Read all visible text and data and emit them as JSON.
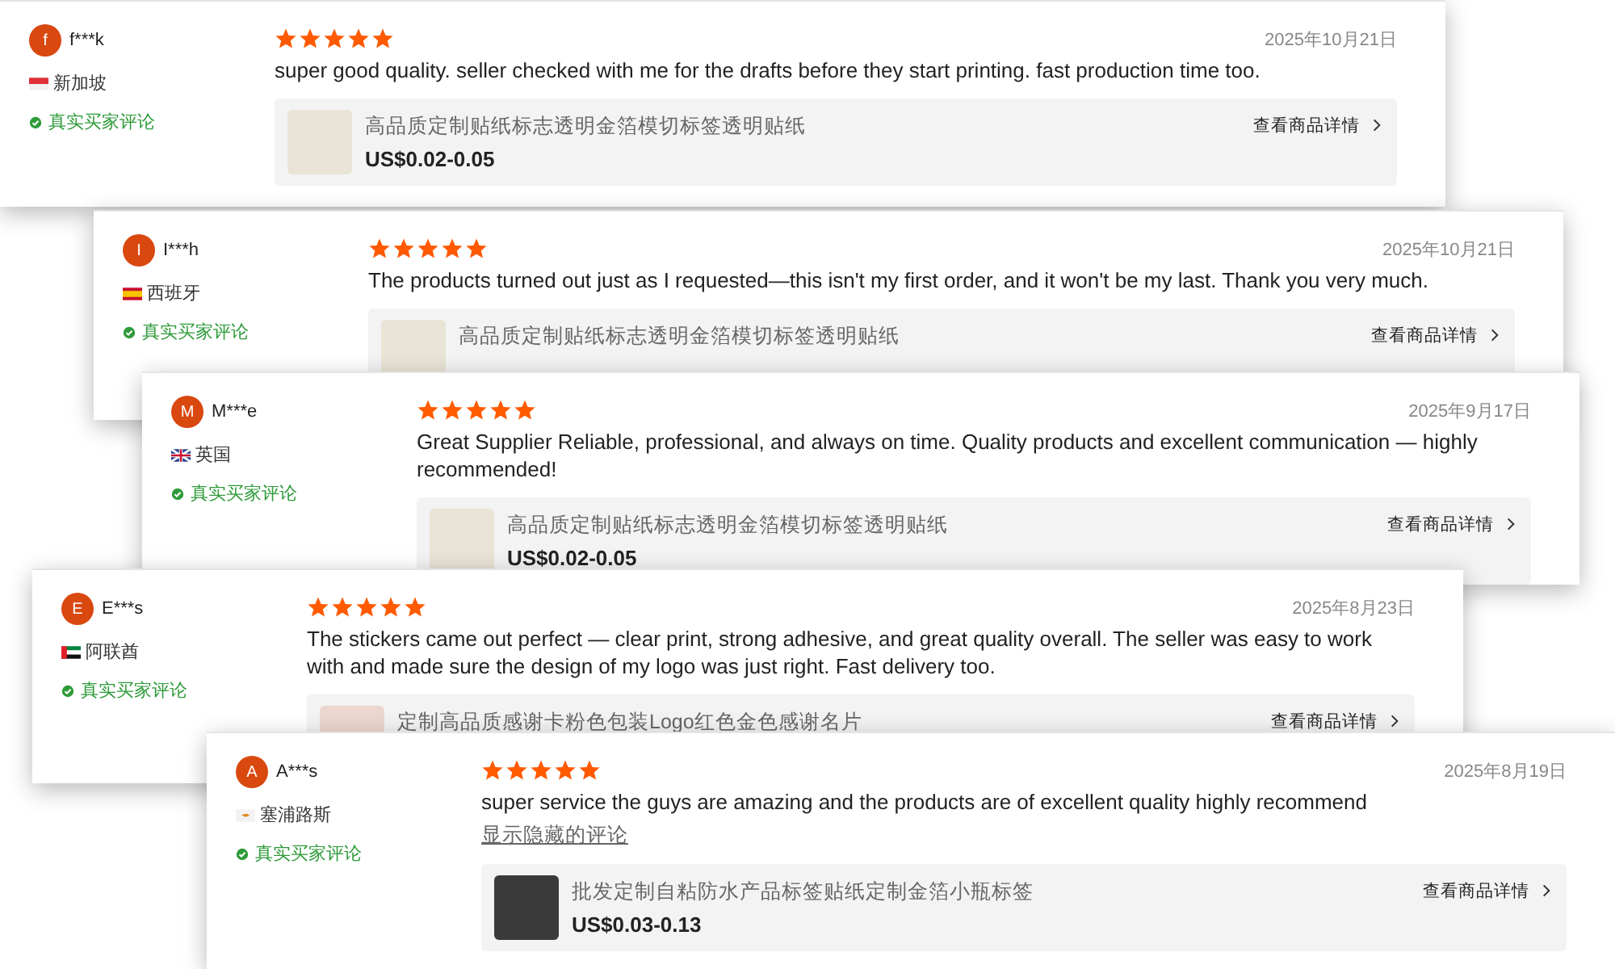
{
  "reviews": [
    {
      "avatar_letter": "f",
      "name": "f***k",
      "country": "新加坡",
      "verified_label": "真实买家评论",
      "stars": 5,
      "date": "2025年10月21日",
      "text": "super good quality. seller checked with me for the drafts before they start printing. fast production time too.",
      "product": {
        "title": "高品质定制贴纸标志透明金箔模切标签透明贴纸",
        "price": "US$0.02-0.05",
        "details_link": "查看商品详情"
      }
    },
    {
      "avatar_letter": "I",
      "name": "I***h",
      "country": "西班牙",
      "verified_label": "真实买家评论",
      "stars": 5,
      "date": "2025年10月21日",
      "text": "The products turned out just as I requested—this isn't my first order, and it won't be my last. Thank you very much.",
      "product": {
        "title": "高品质定制贴纸标志透明金箔模切标签透明贴纸",
        "details_link": "查看商品详情"
      }
    },
    {
      "avatar_letter": "M",
      "name": "M***e",
      "country": "英国",
      "verified_label": "真实买家评论",
      "stars": 5,
      "date": "2025年9月17日",
      "text": "Great Supplier Reliable, professional, and always on time. Quality products and excellent communication — highly recommended!",
      "product": {
        "title": "高品质定制贴纸标志透明金箔模切标签透明贴纸",
        "price": "US$0.02-0.05",
        "details_link": "查看商品详情"
      }
    },
    {
      "avatar_letter": "E",
      "name": "E***s",
      "country": "阿联酋",
      "verified_label": "真实买家评论",
      "stars": 5,
      "date": "2025年8月23日",
      "text": "The stickers came out perfect — clear print, strong adhesive, and great quality overall. The seller was easy to work with and made sure the design of my logo was just right. Fast delivery too.",
      "product": {
        "title": "定制高品质感谢卡粉色包装Logo红色金色感谢名片",
        "details_link": "查看商品详情"
      }
    },
    {
      "avatar_letter": "A",
      "name": "A***s",
      "country": "塞浦路斯",
      "verified_label": "真实买家评论",
      "stars": 5,
      "date": "2025年8月19日",
      "text": "super service the guys are amazing and the products are of excellent quality highly recommend",
      "show_hidden_link": "显示隐藏的评论",
      "product": {
        "title": "批发定制自粘防水产品标签贴纸定制金箔小瓶标签",
        "price": "US$0.03-0.13",
        "details_link": "查看商品详情"
      }
    }
  ]
}
